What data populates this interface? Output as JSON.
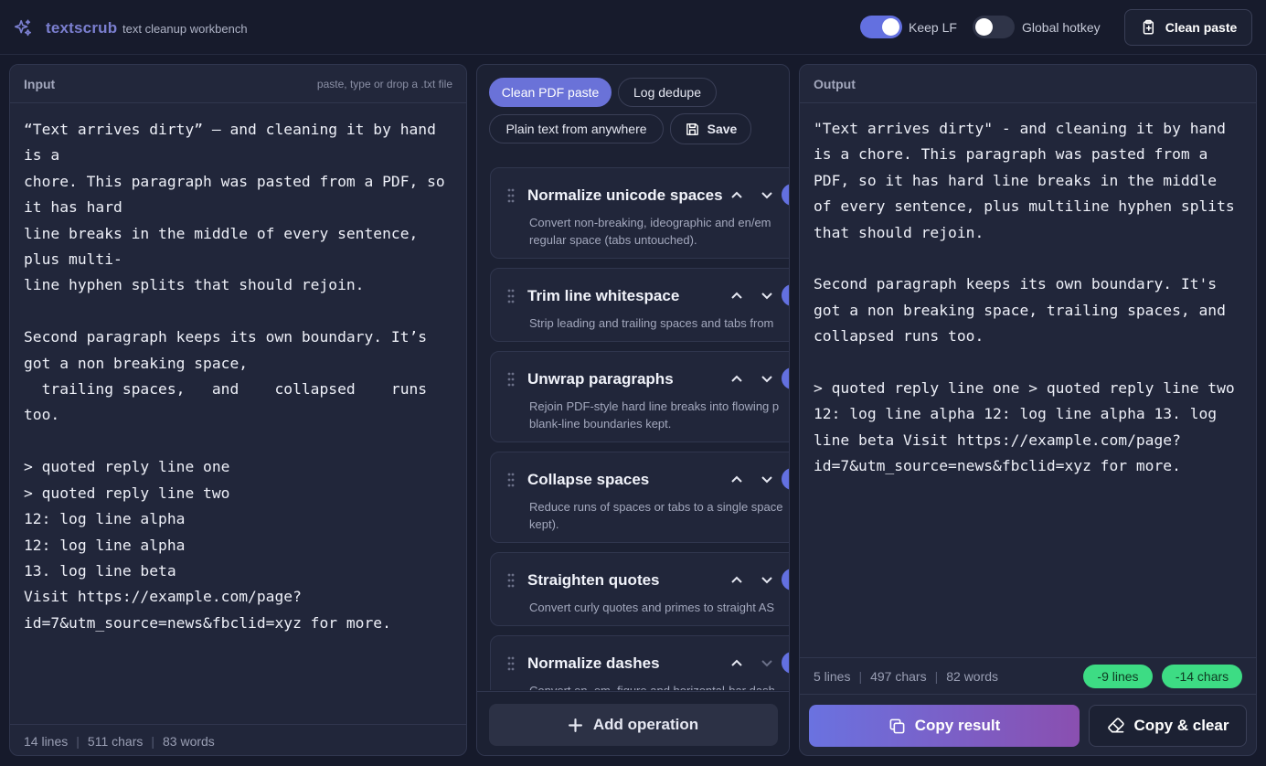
{
  "app": {
    "name": "textscrub",
    "tagline": "text cleanup workbench"
  },
  "toggles": {
    "keep_lf": {
      "label": "Keep LF",
      "on": true
    },
    "global_hotkey": {
      "label": "Global hotkey",
      "on": false
    }
  },
  "header": {
    "clean_paste_label": "Clean paste"
  },
  "input": {
    "title": "Input",
    "hint": "paste, type or drop a .txt file",
    "text": "“Text arrives dirty” — and cleaning it by hand is a\nchore. This paragraph was pasted from a PDF, so it has hard\nline breaks in the middle of every sentence, plus multi-\nline hyphen splits that should rejoin.\n\nSecond paragraph keeps its own boundary. It’s got a non breaking space,\n  trailing spaces,   and    collapsed    runs too.\n\n> quoted reply line one\n> quoted reply line two\n12: log line alpha\n12: log line alpha\n13. log line beta\nVisit https://example.com/page?id=7&utm_source=news&fbclid=xyz for more.",
    "stats": {
      "lines": "14 lines",
      "chars": "511 chars",
      "words": "83 words"
    }
  },
  "presets": {
    "clean_pdf": "Clean PDF paste",
    "log_dedupe": "Log dedupe",
    "plain_text": "Plain text from anywhere",
    "save": "Save"
  },
  "operations": [
    {
      "title": "Normalize unicode spaces",
      "desc": "Convert non-breaking, ideographic and en/em regular space (tabs untouched)."
    },
    {
      "title": "Trim line whitespace",
      "desc": "Strip leading and trailing spaces and tabs from"
    },
    {
      "title": "Unwrap paragraphs",
      "desc": "Rejoin PDF-style hard line breaks into flowing p blank-line boundaries kept."
    },
    {
      "title": "Collapse spaces",
      "desc": "Reduce runs of spaces or tabs to a single space kept)."
    },
    {
      "title": "Straighten quotes",
      "desc": "Convert curly quotes and primes to straight AS"
    },
    {
      "title": "Normalize dashes",
      "desc": "Convert en, em, figure and horizontal-bar dash"
    }
  ],
  "add_operation_label": "Add operation",
  "output": {
    "title": "Output",
    "text": "\"Text arrives dirty\" - and cleaning it by hand is a chore. This paragraph was pasted from a PDF, so it has hard line breaks in the middle of every sentence, plus multiline hyphen splits that should rejoin.\n\nSecond paragraph keeps its own boundary. It's got a non breaking space, trailing spaces, and collapsed runs too.\n\n> quoted reply line one > quoted reply line two 12: log line alpha 12: log line alpha 13. log line beta Visit https://example.com/page?id=7&utm_source=news&fbclid=xyz for more.",
    "stats": {
      "lines": "5 lines",
      "chars": "497 chars",
      "words": "82 words"
    },
    "diff": {
      "lines": "-9 lines",
      "chars": "-14 chars"
    }
  },
  "actions": {
    "copy_result": "Copy result",
    "copy_clear": "Copy & clear"
  },
  "colors": {
    "accent": "#6370e0",
    "success": "#3ddc84",
    "background": "#161a2b"
  }
}
